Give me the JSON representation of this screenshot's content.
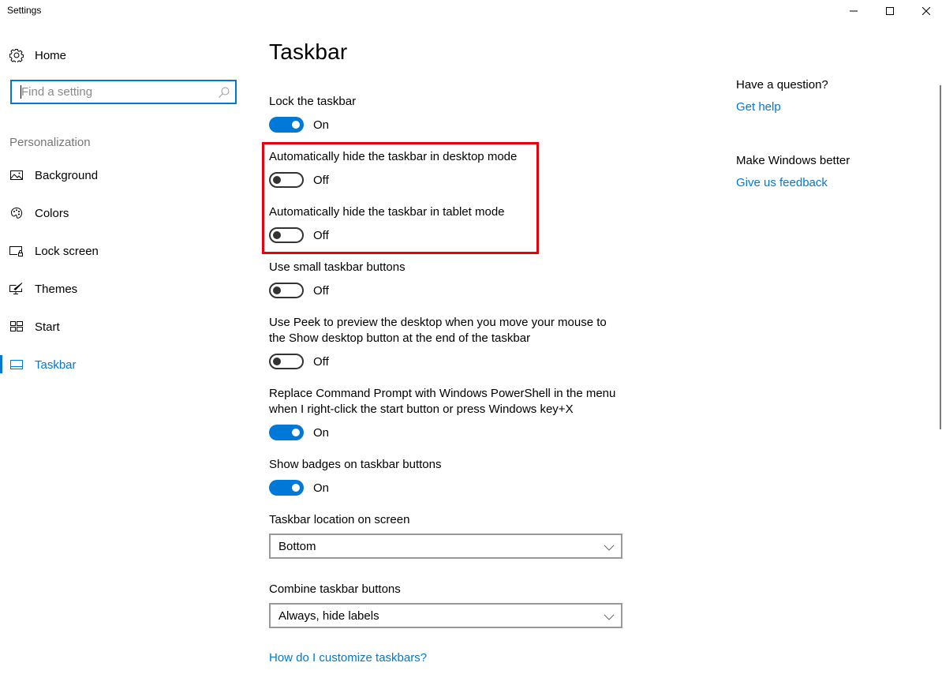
{
  "window": {
    "title": "Settings",
    "controls": {
      "minimize": "minimize",
      "maximize": "maximize",
      "close": "close"
    }
  },
  "sidebar": {
    "home_label": "Home",
    "search": {
      "placeholder": "Find a setting",
      "value": ""
    },
    "section_title": "Personalization",
    "items": [
      {
        "label": "Background",
        "icon": "picture-icon",
        "selected": false
      },
      {
        "label": "Colors",
        "icon": "palette-icon",
        "selected": false
      },
      {
        "label": "Lock screen",
        "icon": "lock-screen-icon",
        "selected": false
      },
      {
        "label": "Themes",
        "icon": "themes-brush-icon",
        "selected": false
      },
      {
        "label": "Start",
        "icon": "start-tiles-icon",
        "selected": false
      },
      {
        "label": "Taskbar",
        "icon": "taskbar-icon",
        "selected": true
      }
    ]
  },
  "main": {
    "title": "Taskbar",
    "settings": [
      {
        "label": "Lock the taskbar",
        "state": "On",
        "on": true
      },
      {
        "label": "Automatically hide the taskbar in desktop mode",
        "state": "Off",
        "on": false
      },
      {
        "label": "Automatically hide the taskbar in tablet mode",
        "state": "Off",
        "on": false
      },
      {
        "label": "Use small taskbar buttons",
        "state": "Off",
        "on": false
      },
      {
        "label_line1": "Use Peek to preview the desktop when you move your mouse to",
        "label_line2": "the Show desktop button at the end of the taskbar",
        "state": "Off",
        "on": false
      },
      {
        "label_line1": "Replace Command Prompt with Windows PowerShell in the menu",
        "label_line2": "when I right-click the start button or press Windows key+X",
        "state": "On",
        "on": true
      },
      {
        "label": "Show badges on taskbar buttons",
        "state": "On",
        "on": true
      }
    ],
    "location": {
      "label": "Taskbar location on screen",
      "value": "Bottom"
    },
    "combine": {
      "label": "Combine taskbar buttons",
      "value": "Always, hide labels"
    },
    "help_link": "How do I customize taskbars?"
  },
  "aside": {
    "question_heading": "Have a question?",
    "get_help": "Get help",
    "better_heading": "Make Windows better",
    "feedback": "Give us feedback"
  },
  "colors": {
    "accent": "#0078d7",
    "highlight_box": "#e8000b",
    "secondary_text": "#767676"
  }
}
